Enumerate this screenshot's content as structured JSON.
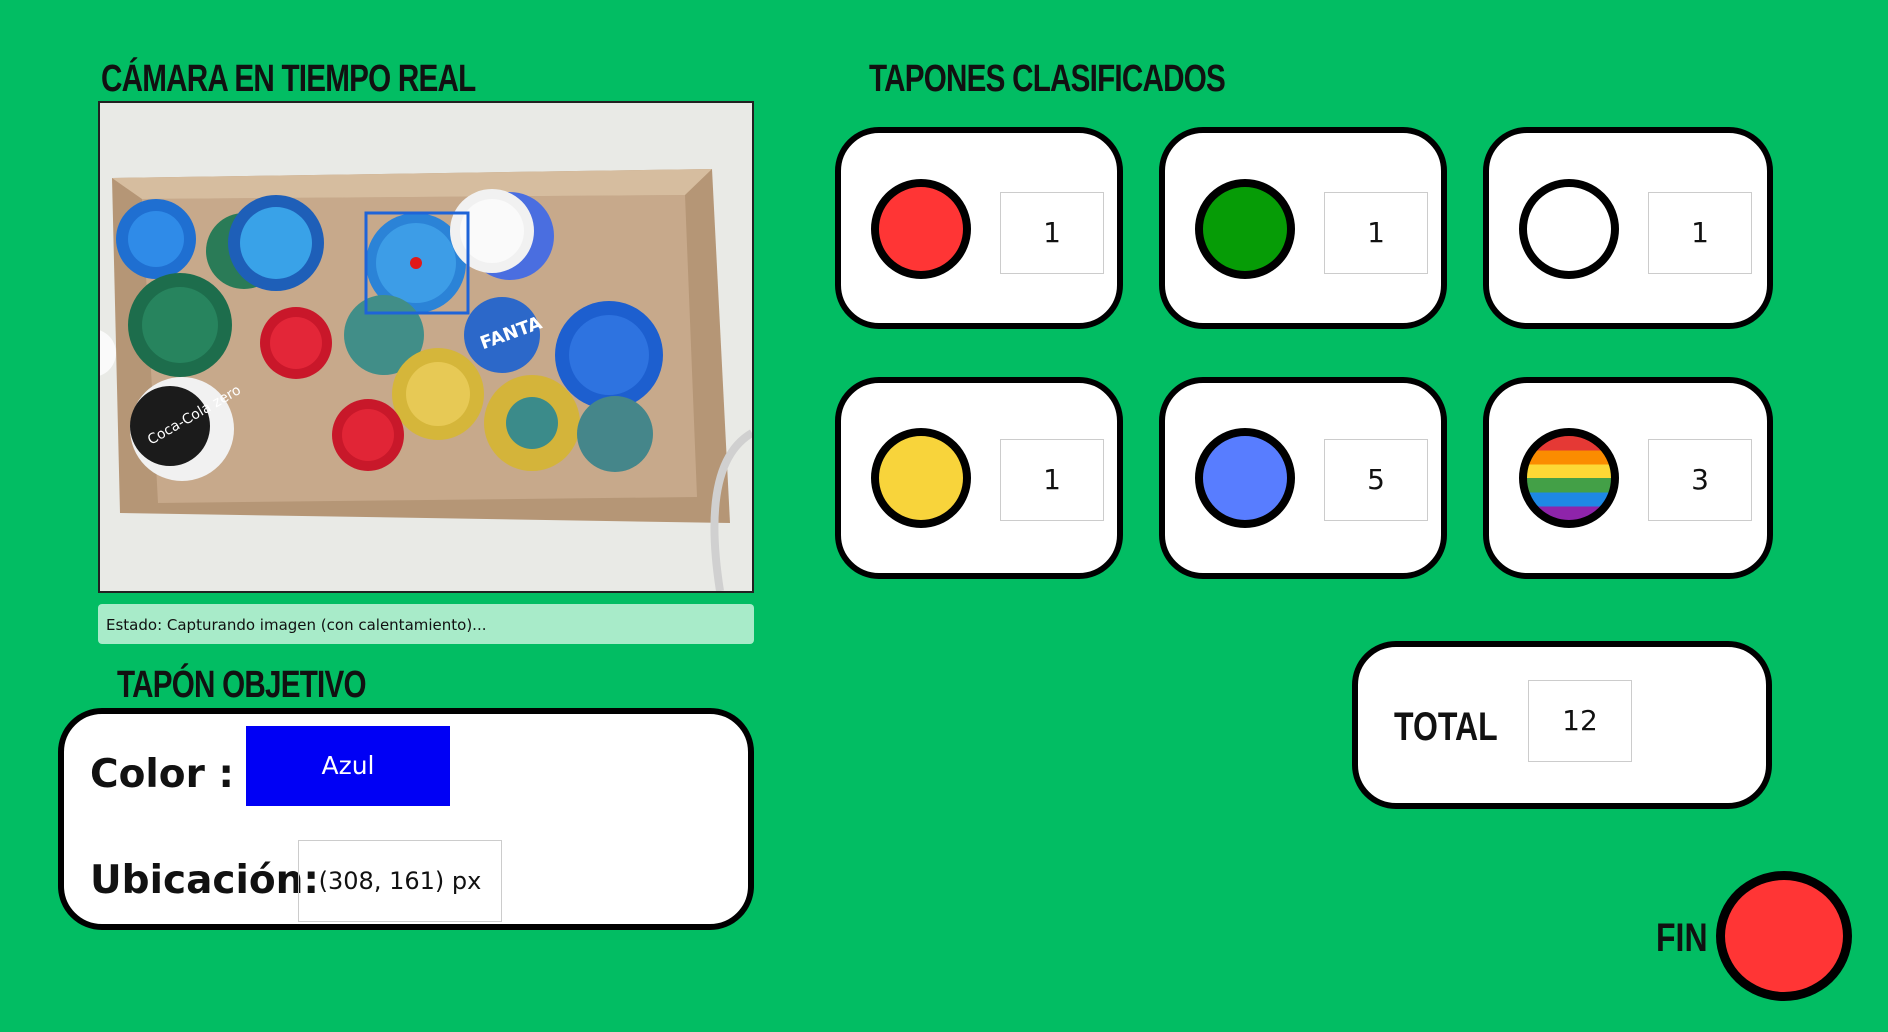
{
  "camera": {
    "title": "CÁMARA EN TIEMPO REAL",
    "status": "Estado: Capturando imagen (con calentamiento)...",
    "image_text": [
      "FANTA",
      "Coca-Cola zero",
      "Coca-Cola"
    ]
  },
  "classified": {
    "title": "TAPONES CLASIFICADOS",
    "items": [
      {
        "color_name": "red",
        "color": "#ff3535",
        "count": "1"
      },
      {
        "color_name": "green",
        "color": "#069c06",
        "count": "1"
      },
      {
        "color_name": "white",
        "color": "#ffffff",
        "count": "1"
      },
      {
        "color_name": "yellow",
        "color": "#f8d43b",
        "count": "1"
      },
      {
        "color_name": "blue",
        "color": "#587dff",
        "count": "5"
      },
      {
        "color_name": "multicolor",
        "color": "rainbow",
        "count": "3"
      }
    ]
  },
  "target": {
    "title": "TAPÓN OBJETIVO",
    "color_label": "Color :",
    "color_value": "Azul",
    "color_hex": "#0000f5",
    "location_label": "Ubicación:",
    "location_value": "(308, 161) px"
  },
  "total": {
    "label": "TOTAL",
    "value": "12"
  },
  "fin": {
    "label": "FIN",
    "color": "#ff3535"
  }
}
